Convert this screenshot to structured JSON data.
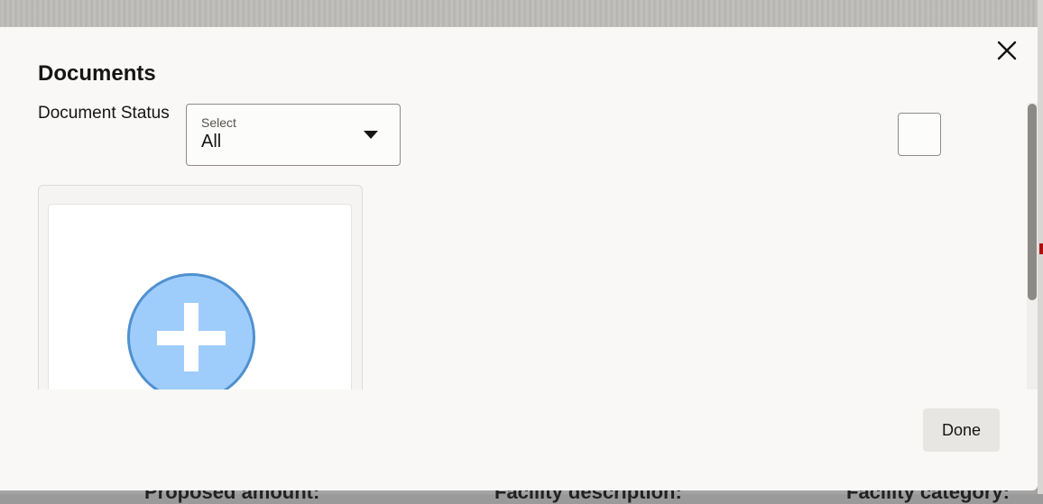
{
  "dialog": {
    "title": "Documents",
    "close_icon": "close-icon"
  },
  "filter": {
    "label": "Document Status",
    "select_caption": "Select",
    "select_value": "All"
  },
  "upload_card": {
    "icon": "add-circle-icon"
  },
  "footer": {
    "done_label": "Done"
  },
  "background": {
    "field_1": "Proposed amount:",
    "field_2": "Facility description:",
    "field_3": "Facility category:"
  },
  "colors": {
    "add_circle_fill": "#9fcdfb",
    "add_circle_border": "#4f90cf",
    "modal_bg": "#f9f8f6"
  }
}
